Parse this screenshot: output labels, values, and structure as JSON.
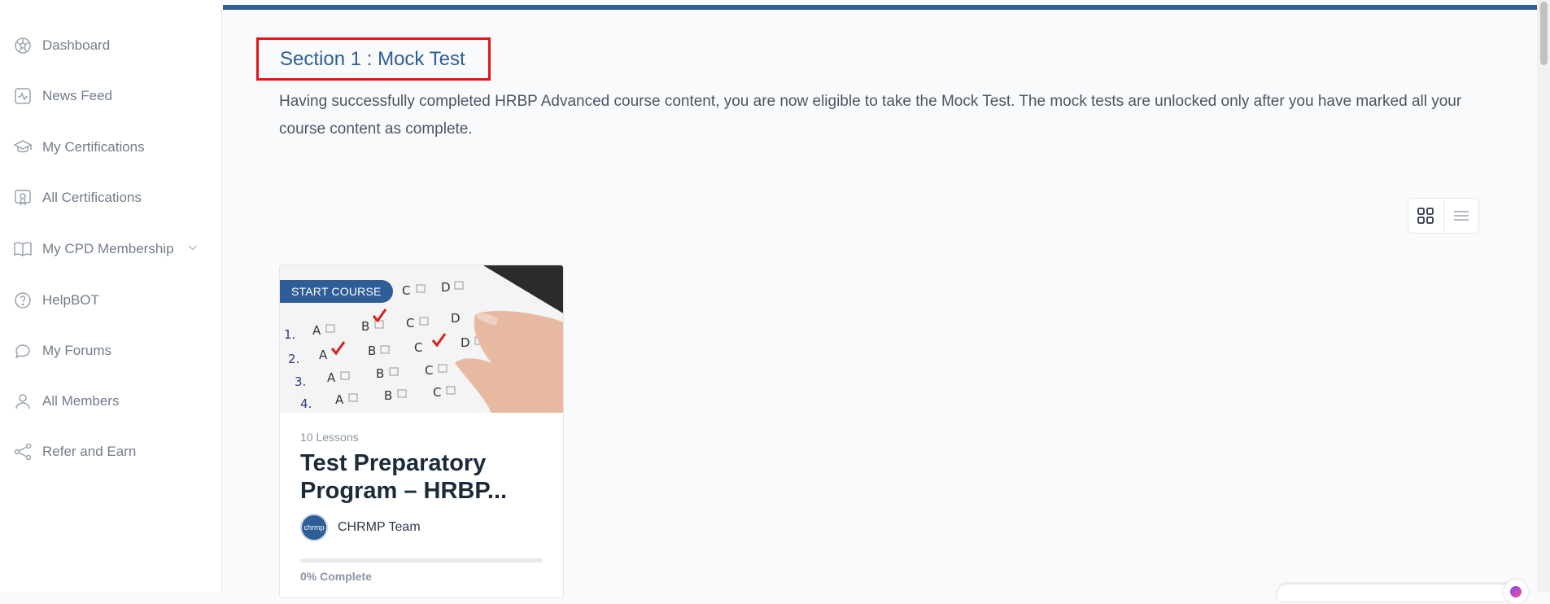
{
  "sidebar": {
    "items": [
      {
        "label": "Dashboard",
        "icon": "dashboard-icon"
      },
      {
        "label": "News Feed",
        "icon": "activity-icon"
      },
      {
        "label": "My Certifications",
        "icon": "graduation-cap-icon"
      },
      {
        "label": "All Certifications",
        "icon": "certificate-icon"
      },
      {
        "label": "My CPD Membership",
        "icon": "book-icon"
      },
      {
        "label": "HelpBOT",
        "icon": "help-icon"
      },
      {
        "label": "My Forums",
        "icon": "chat-icon"
      },
      {
        "label": "All Members",
        "icon": "user-icon"
      },
      {
        "label": "Refer and Earn",
        "icon": "share-icon"
      }
    ]
  },
  "main": {
    "section_title": "Section 1 : Mock Test",
    "intro": "Having successfully completed HRBP Advanced course content, you are now eligible to take the Mock Test. The mock tests are unlocked only after you have marked all your course content as complete."
  },
  "course_card": {
    "badge": "START COURSE",
    "lessons": "10 Lessons",
    "title": "Test Preparatory Program – HRBP...",
    "author": "CHRMP Team",
    "avatar_text": "chrmp",
    "progress_percent": 0,
    "progress_label": "0% Complete"
  },
  "colors": {
    "accent": "#2e5d97",
    "highlight_box": "#e3131b"
  }
}
